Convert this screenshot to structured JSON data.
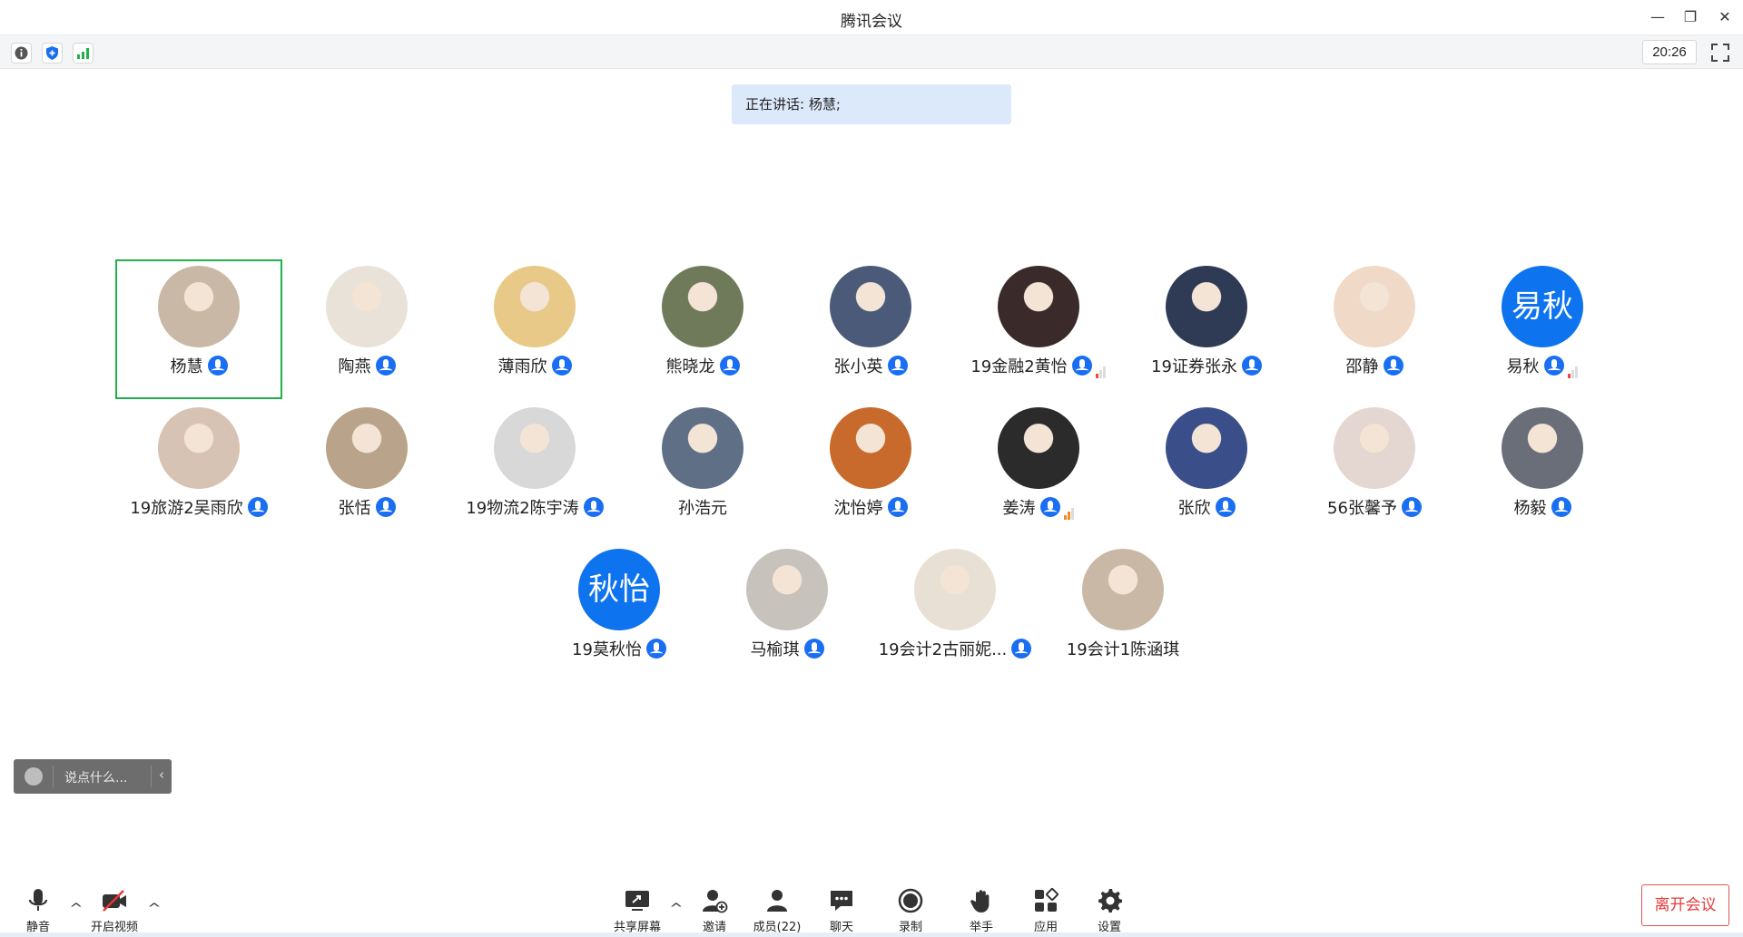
{
  "window": {
    "title": "腾讯会议"
  },
  "toolbar": {
    "clock": "20:26"
  },
  "banner": {
    "speaking_text": "正在讲话: 杨慧;"
  },
  "participants": [
    {
      "name": "杨慧",
      "avatar": "photo",
      "mic": true,
      "active": true
    },
    {
      "name": "陶燕",
      "avatar": "photo",
      "mic": true
    },
    {
      "name": "薄雨欣",
      "avatar": "photo",
      "mic": true
    },
    {
      "name": "熊晓龙",
      "avatar": "photo",
      "mic": true
    },
    {
      "name": "张小英",
      "avatar": "photo",
      "mic": true
    },
    {
      "name": "19金融2黄怡",
      "avatar": "photo",
      "mic": true,
      "signal": "weak-red"
    },
    {
      "name": "19证券张永",
      "avatar": "photo",
      "mic": true
    },
    {
      "name": "邵静",
      "avatar": "photo",
      "mic": true
    },
    {
      "name": "易秋",
      "avatar_text": "易秋",
      "mic": true,
      "signal": "weak-red"
    },
    {
      "name": "19旅游2吴雨欣",
      "avatar": "photo",
      "mic": true
    },
    {
      "name": "张恬",
      "avatar": "photo",
      "mic": true
    },
    {
      "name": "19物流2陈宇涛",
      "avatar": "photo",
      "mic": true
    },
    {
      "name": "孙浩元",
      "avatar": "photo",
      "mic": false
    },
    {
      "name": "沈怡婷",
      "avatar": "photo",
      "mic": true
    },
    {
      "name": "姜涛",
      "avatar": "photo",
      "mic": true,
      "signal": "medium-orange"
    },
    {
      "name": "张欣",
      "avatar": "photo",
      "mic": true
    },
    {
      "name": "56张馨予",
      "avatar": "photo",
      "mic": true
    },
    {
      "name": "杨毅",
      "avatar": "photo",
      "mic": true
    },
    {
      "name": "19莫秋怡",
      "avatar_text": "秋怡",
      "mic": true
    },
    {
      "name": "马榆琪",
      "avatar": "photo",
      "mic": true
    },
    {
      "name": "19会计2古丽妮...",
      "avatar": "photo",
      "mic": true
    },
    {
      "name": "19会计1陈涵琪",
      "avatar": "photo",
      "mic": false
    }
  ],
  "chat": {
    "placeholder": "说点什么..."
  },
  "bottom": {
    "mute": "静音",
    "video": "开启视频",
    "share": "共享屏幕",
    "invite": "邀请",
    "members": "成员(22)",
    "chat": "聊天",
    "record": "录制",
    "raise_hand": "举手",
    "apps": "应用",
    "settings": "设置",
    "leave": "离开会议"
  },
  "colors": {
    "accent": "#1a6ef2",
    "active_border": "#21b14b",
    "leave": "#e53a3a",
    "banner": "#dce9fb"
  }
}
